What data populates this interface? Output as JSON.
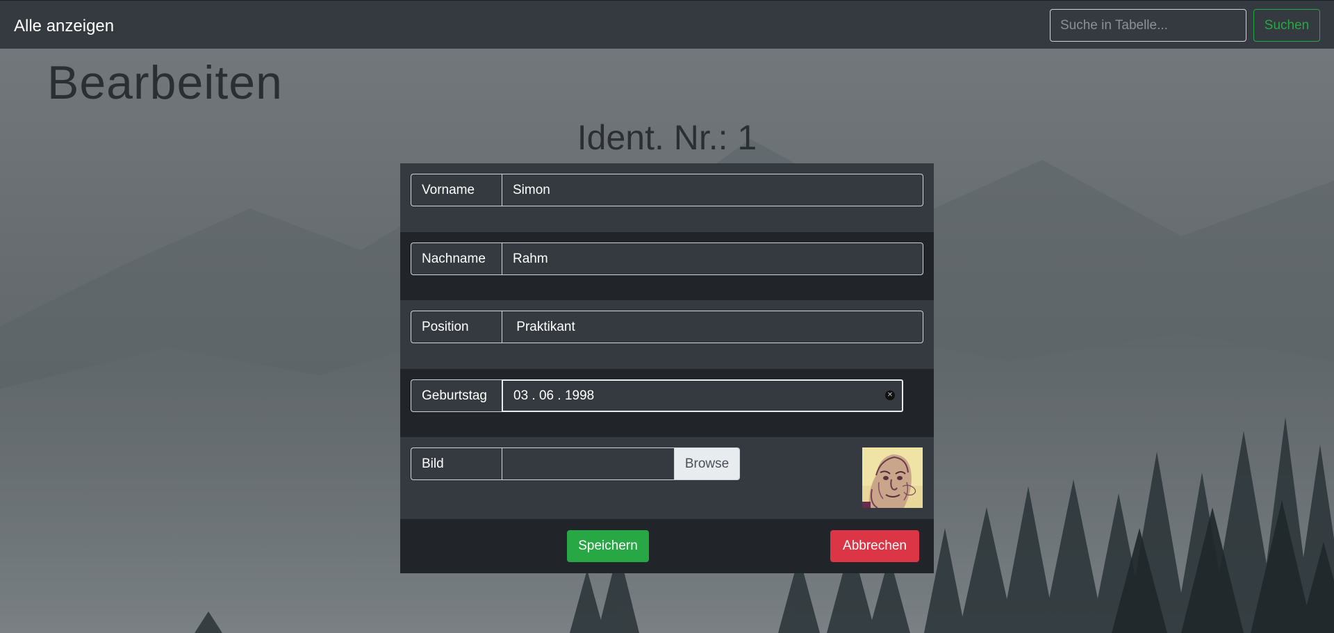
{
  "navbar": {
    "brand": "Alle anzeigen",
    "search_placeholder": "Suche in Tabelle...",
    "search_button": "Suchen"
  },
  "page": {
    "title": "Bearbeiten",
    "ident_heading": "Ident. Nr.: 1"
  },
  "form": {
    "vorname": {
      "label": "Vorname",
      "value": "Simon"
    },
    "nachname": {
      "label": "Nachname",
      "value": "Rahm"
    },
    "position": {
      "label": "Position",
      "value": " Praktikant"
    },
    "geburtstag": {
      "label": "Geburtstag",
      "value": "03 . 06 . 1998"
    },
    "bild": {
      "label": "Bild",
      "browse_label": "Browse"
    },
    "save_label": "Speichern",
    "cancel_label": "Abbrechen"
  },
  "colors": {
    "navbar_bg": "#343a40",
    "success": "#28a745",
    "danger": "#dc3545",
    "panel_bg": "#343a40"
  },
  "icons": {
    "date_clear": "clear-x-icon",
    "profile_picture": "profile-thumbnail"
  }
}
